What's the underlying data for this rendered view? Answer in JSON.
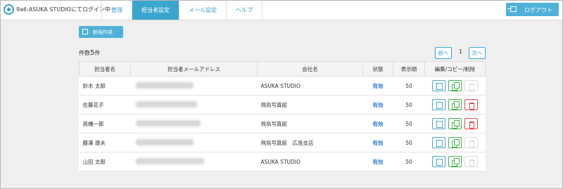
{
  "header": {
    "login_status": "9a6:ASUKA STUDIOにてログイン中",
    "nav": [
      {
        "label": "管理",
        "active": false
      },
      {
        "label": "担当者設定",
        "active": true
      },
      {
        "label": "メール設定",
        "active": false
      },
      {
        "label": "ヘルプ",
        "active": false
      }
    ],
    "logout_label": "ログアウト"
  },
  "toolbar": {
    "new_label": "新規作成",
    "count_prefix": "件数",
    "count_value": "5",
    "count_suffix": "件"
  },
  "pager": {
    "prev_label": "前へ",
    "page": "1",
    "next_label": "次へ"
  },
  "table": {
    "columns": [
      "担当者名",
      "担当者メールアドレス",
      "会社名",
      "状態",
      "表示順",
      "編集/コピー/削除"
    ],
    "rows": [
      {
        "name": "鈴木 太郎",
        "company": "ASUKA STUDIO",
        "status": "有効",
        "order": "50",
        "delete_enabled": false
      },
      {
        "name": "佐藤花子",
        "company": "飛鳥写真館",
        "status": "有効",
        "order": "50",
        "delete_enabled": true
      },
      {
        "name": "高橋一郎",
        "company": "飛鳥写真館",
        "status": "有効",
        "order": "50",
        "delete_enabled": true
      },
      {
        "name": "藤澤 康夫",
        "company": "飛鳥写真館　広島支店",
        "status": "有効",
        "order": "50",
        "delete_enabled": false
      },
      {
        "name": "山田 太郎",
        "company": "ASUKA STUDIO",
        "status": "有効",
        "order": "50",
        "delete_enabled": false
      }
    ]
  },
  "colors": {
    "accent": "#3aa6cf",
    "status_link": "#2a7bd6",
    "copy": "#4caf50",
    "delete": "#e04a4a"
  }
}
